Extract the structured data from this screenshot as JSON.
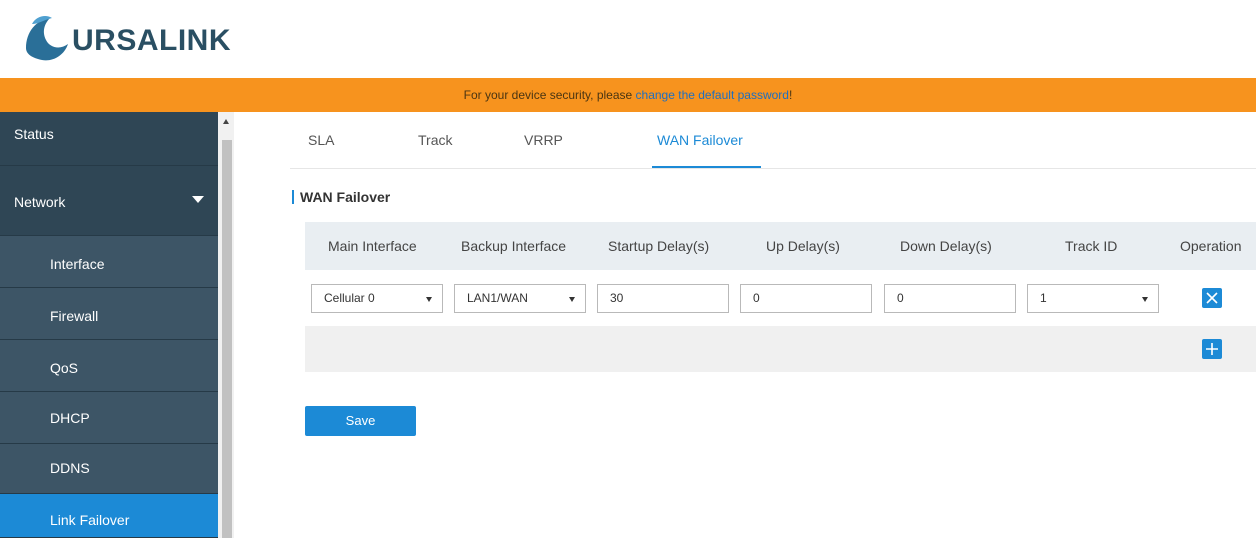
{
  "brand": {
    "logo_text": "URSALINK"
  },
  "banner": {
    "prefix": "For your device security, please ",
    "link": "change the default password",
    "suffix": "!"
  },
  "sidebar": {
    "items": [
      {
        "label": "Status"
      },
      {
        "label": "Network"
      },
      {
        "label": "Interface"
      },
      {
        "label": "Firewall"
      },
      {
        "label": "QoS"
      },
      {
        "label": "DHCP"
      },
      {
        "label": "DDNS"
      },
      {
        "label": "Link Failover"
      }
    ]
  },
  "tabs": [
    {
      "label": "SLA"
    },
    {
      "label": "Track"
    },
    {
      "label": "VRRP"
    },
    {
      "label": "WAN Failover"
    }
  ],
  "section": {
    "title": "WAN Failover"
  },
  "table": {
    "headers": [
      "Main Interface",
      "Backup Interface",
      "Startup Delay(s)",
      "Up Delay(s)",
      "Down Delay(s)",
      "Track ID",
      "Operation"
    ],
    "rows": [
      {
        "main_interface": "Cellular 0",
        "backup_interface": "LAN1/WAN",
        "startup_delay": "30",
        "up_delay": "0",
        "down_delay": "0",
        "track_id": "1"
      }
    ]
  },
  "actions": {
    "save_label": "Save"
  },
  "colors": {
    "accent": "#1c8ad6",
    "banner": "#f7931e",
    "sidebar": "#2f4655"
  }
}
